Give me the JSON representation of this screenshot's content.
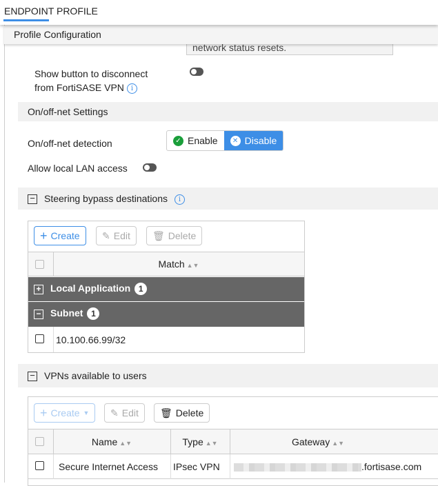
{
  "header": {
    "tab": "ENDPOINT PROFILE"
  },
  "section": {
    "title": "Profile Configuration",
    "note_text": "network status resets."
  },
  "disconnect": {
    "label_line1": "Show button to disconnect",
    "label_line2": "from FortiSASE VPN",
    "enabled": false
  },
  "onoff": {
    "title": "On/off-net Settings",
    "detection_label": "On/off-net detection",
    "enable_label": "Enable",
    "disable_label": "Disable",
    "selected": "Disable",
    "lan_label": "Allow local LAN access",
    "lan_enabled": false
  },
  "steering": {
    "title": "Steering bypass destinations",
    "create": "Create",
    "edit": "Edit",
    "delete": "Delete",
    "col_match": "Match",
    "groups": [
      {
        "name": "Local Application",
        "count": "1"
      },
      {
        "name": "Subnet",
        "count": "1"
      }
    ],
    "rows": [
      "10.100.66.99/32"
    ]
  },
  "vpns": {
    "title": "VPNs available to users",
    "create": "Create",
    "edit": "Edit",
    "delete": "Delete",
    "columns": [
      "Name",
      "Type",
      "Gateway"
    ],
    "rows": [
      {
        "name": "Secure Internet Access",
        "type": "IPsec VPN",
        "gateway": ".fortisase.com"
      }
    ]
  },
  "colors": {
    "accent": "#3d8ee6",
    "group_bg": "#666666",
    "enable_green": "#1a9e3a"
  }
}
